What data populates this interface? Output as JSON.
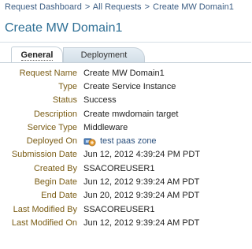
{
  "breadcrumb": {
    "items": [
      "Request Dashboard",
      "All Requests"
    ],
    "separator": ">",
    "current": "Create MW Domain1"
  },
  "page_title": "Create MW Domain1",
  "tabs": [
    {
      "label": "General",
      "selected": true
    },
    {
      "label": "Deployment",
      "selected": false
    }
  ],
  "details": [
    {
      "label": "Request Name",
      "value": "Create MW Domain1"
    },
    {
      "label": "Type",
      "value": "Create Service Instance"
    },
    {
      "label": "Status",
      "value": "Success"
    },
    {
      "label": "Description",
      "value": "Create mwdomain target"
    },
    {
      "label": "Service Type",
      "value": "Middleware"
    },
    {
      "label": "Deployed On",
      "value": "test paas zone",
      "icon": "zone-icon"
    },
    {
      "label": "Submission Date",
      "value": "Jun 12, 2012 4:39:24 PM PDT"
    },
    {
      "label": "Created By",
      "value": "SSACOREUSER1"
    },
    {
      "label": "Begin Date",
      "value": "Jun 12, 2012 9:39:24 AM PDT"
    },
    {
      "label": "End Date",
      "value": "Jun 20, 2012 9:39:24 AM PDT"
    },
    {
      "label": "Last Modified By",
      "value": "SSACOREUSER1"
    },
    {
      "label": "Last Modified On",
      "value": "Jun 12, 2012 9:39:24 AM PDT"
    }
  ],
  "colors": {
    "label": "#7a5c14",
    "title": "#2e6f95",
    "link": "#3b5d83"
  }
}
